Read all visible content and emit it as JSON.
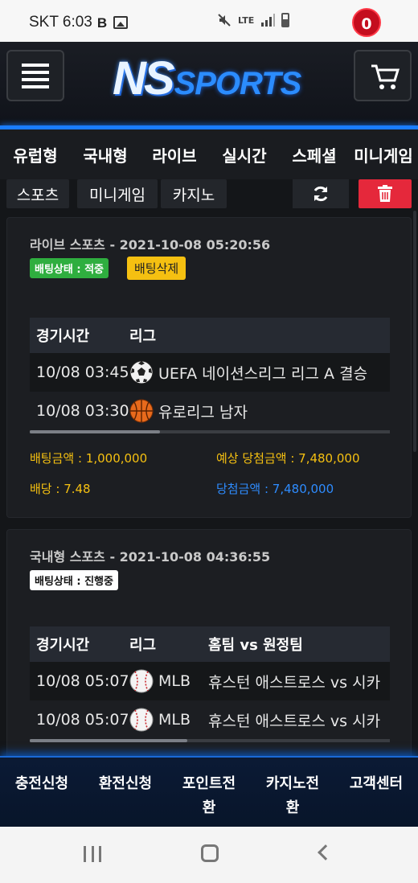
{
  "status_bar": {
    "carrier_time": "SKT 6:03",
    "b_icon": "B",
    "lte": "LTE"
  },
  "header": {
    "logo_ns": "NS",
    "logo_sports": "SPORTS",
    "cart_count": "0"
  },
  "nav_tabs": [
    "유럽형",
    "국내형",
    "라이브",
    "실시간",
    "스페셜",
    "미니게임"
  ],
  "sub_tabs": [
    "스포츠",
    "미니게임",
    "카지노"
  ],
  "cards": [
    {
      "title": "라이브 스포츠 - 2021-10-08 05:20:56",
      "status": "배팅상태 : 적중",
      "delete_label": "배팅삭제",
      "headers": {
        "time": "경기시간",
        "league": "리그"
      },
      "rows": [
        {
          "time": "10/08 03:45",
          "league": "UEFA 네이션스리그 리그 A 결승",
          "sport": "soccer"
        },
        {
          "time": "10/08 03:30",
          "league": "유로리그 남자",
          "sport": "basketball"
        }
      ],
      "bet_amount": "배팅금액 : 1,000,000",
      "expected_win": "예상 당첨금액 : 7,480,000",
      "odds": "배당 : 7.48",
      "win_amount": "당첨금액 : 7,480,000"
    },
    {
      "title": "국내형 스포츠 - 2021-10-08 04:36:55",
      "status": "배팅상태 : 진행중",
      "headers": {
        "time": "경기시간",
        "league": "리그",
        "match": "홈팀 vs 원정팀"
      },
      "rows": [
        {
          "time": "10/08 05:07",
          "league": "MLB",
          "match": "휴스턴 애스트로스 vs 시카",
          "sport": "baseball"
        },
        {
          "time": "10/08 05:07",
          "league": "MLB",
          "match": "휴스턴 애스트로스 vs 시카",
          "sport": "baseball"
        }
      ]
    }
  ],
  "bottom_bar": [
    {
      "line1": "충전신청",
      "line2": ""
    },
    {
      "line1": "환전신청",
      "line2": ""
    },
    {
      "line1": "포인트전",
      "line2": "환"
    },
    {
      "line1": "카지노전",
      "line2": "환"
    },
    {
      "line1": "고객센터",
      "line2": ""
    }
  ],
  "colors": {
    "accent_blue": "#1a7cff",
    "delete_red": "#e5283b",
    "win_yellow": "#f5c011",
    "status_green": "#2fae3f"
  }
}
